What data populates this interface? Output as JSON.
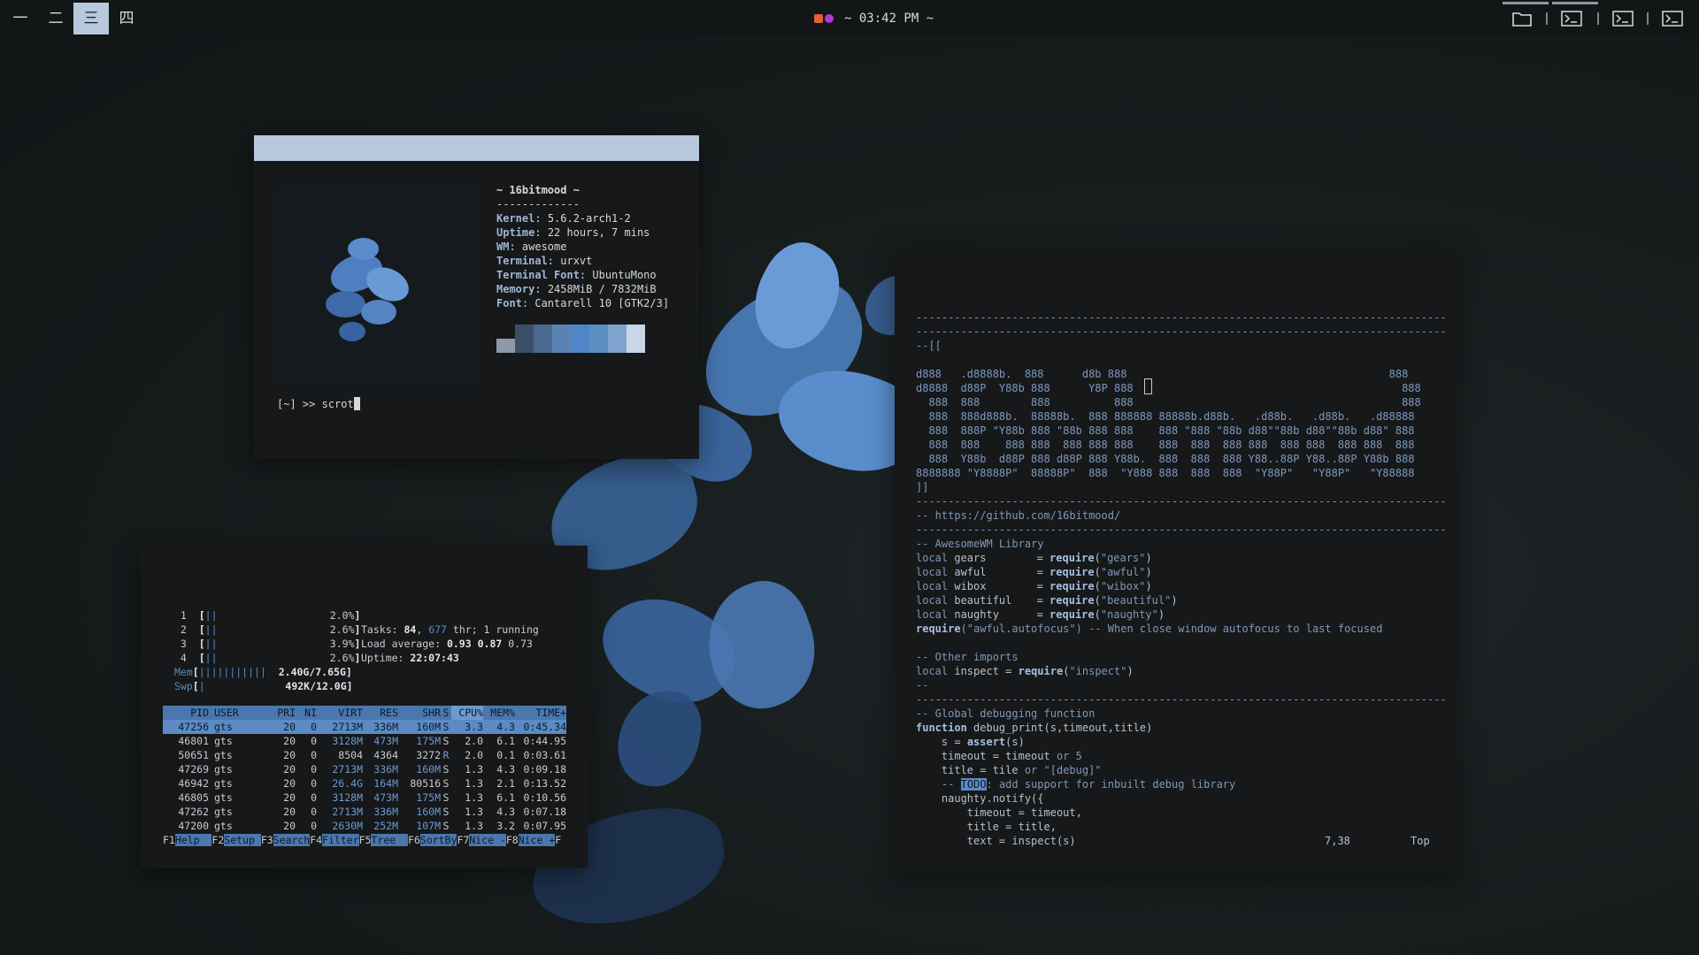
{
  "topbar": {
    "tags": [
      "一",
      "二",
      "三",
      "四"
    ],
    "active_tag_index": 2,
    "clock": "~ 03:42 PM ~",
    "tray_icons": [
      "folder-icon",
      "terminal-icon",
      "terminal-icon",
      "terminal-icon"
    ]
  },
  "neofetch": {
    "header": "~ 16bitmood ~",
    "divider": "-------------",
    "fields": [
      {
        "key": "Kernel",
        "value": "5.6.2-arch1-2"
      },
      {
        "key": "Uptime",
        "value": "22 hours, 7 mins"
      },
      {
        "key": "WM",
        "value": "awesome"
      },
      {
        "key": "Terminal",
        "value": "urxvt"
      },
      {
        "key": "Terminal Font",
        "value": "UbuntuMono"
      },
      {
        "key": "Memory",
        "value": "2458MiB / 7832MiB"
      },
      {
        "key": "Font",
        "value": "Cantarell 10 [GTK2/3]"
      }
    ],
    "swatch_colors": [
      "#8d99a6",
      "#3b4f66",
      "#4a6a92",
      "#5a82b3",
      "#4f86c9",
      "#5a8fc0",
      "#7fa3cf",
      "#c8d6e8"
    ],
    "prompt": "[~] >> scrot"
  },
  "htop": {
    "cpus": [
      {
        "n": "1",
        "pct": "2.0%"
      },
      {
        "n": "2",
        "pct": "2.6%"
      },
      {
        "n": "3",
        "pct": "3.9%"
      },
      {
        "n": "4",
        "pct": "2.6%"
      }
    ],
    "mem": {
      "label": "Mem",
      "value": "2.40G/7.65G"
    },
    "swp": {
      "label": "Swp",
      "value": "492K/12.0G"
    },
    "tasks_label": "Tasks:",
    "tasks": "84",
    "threads": "677",
    "running_text": "thr; 1 running",
    "load_label": "Load average:",
    "load": [
      "0.93",
      "0.87",
      "0.73"
    ],
    "uptime_label": "Uptime:",
    "uptime": "22:07:43",
    "columns": [
      "PID",
      "USER",
      "PRI",
      "NI",
      "VIRT",
      "RES",
      "SHR",
      "S",
      "CPU%",
      "MEM%",
      "TIME+"
    ],
    "rows": [
      [
        "47256",
        "gts",
        "20",
        "0",
        "2713M",
        "336M",
        "160M",
        "S",
        "3.3",
        "4.3",
        "0:45.34"
      ],
      [
        "46801",
        "gts",
        "20",
        "0",
        "3128M",
        "473M",
        "175M",
        "S",
        "2.0",
        "6.1",
        "0:44.95"
      ],
      [
        "50651",
        "gts",
        "20",
        "0",
        "8504",
        "4364",
        "3272",
        "R",
        "2.0",
        "0.1",
        "0:03.61"
      ],
      [
        "47269",
        "gts",
        "20",
        "0",
        "2713M",
        "336M",
        "160M",
        "S",
        "1.3",
        "4.3",
        "0:09.18"
      ],
      [
        "46942",
        "gts",
        "20",
        "0",
        "26.4G",
        "164M",
        "80516",
        "S",
        "1.3",
        "2.1",
        "0:13.52"
      ],
      [
        "46805",
        "gts",
        "20",
        "0",
        "3128M",
        "473M",
        "175M",
        "S",
        "1.3",
        "6.1",
        "0:10.56"
      ],
      [
        "47262",
        "gts",
        "20",
        "0",
        "2713M",
        "336M",
        "160M",
        "S",
        "1.3",
        "4.3",
        "0:07.18"
      ],
      [
        "47200",
        "gts",
        "20",
        "0",
        "2630M",
        "252M",
        "107M",
        "S",
        "1.3",
        "3.2",
        "0:07.95"
      ]
    ],
    "fkeys": [
      {
        "key": "F1",
        "label": "Help  "
      },
      {
        "key": "F2",
        "label": "Setup "
      },
      {
        "key": "F3",
        "label": "Search"
      },
      {
        "key": "F4",
        "label": "Filter"
      },
      {
        "key": "F5",
        "label": "Tree  "
      },
      {
        "key": "F6",
        "label": "SortBy"
      },
      {
        "key": "F7",
        "label": "Nice -"
      },
      {
        "key": "F8",
        "label": "Nice +"
      },
      {
        "key": "F",
        "label": ""
      }
    ]
  },
  "vim": {
    "dashes": "-----------------------------------------------------------------------------------",
    "open_comment": "--[[",
    "ascii_art": [
      "d888   .d8888b.  888      d8b 888                                         888",
      "d8888  d88P  Y88b 888      Y8P 888                                          888",
      "  888  888        888          888                                          888",
      "  888  888d888b.  88888b.  888 888888 88888b.d88b.   .d88b.   .d88b.   .d88888",
      "  888  888P \"Y88b 888 \"88b 888 888    888 \"888 \"88b d88\"\"88b d88\"\"88b d88\" 888",
      "  888  888    888 888  888 888 888    888  888  888 888  888 888  888 888  888",
      "  888  Y88b  d88P 888 d88P 888 Y88b.  888  888  888 Y88..88P Y88..88P Y88b 888",
      "8888888 \"Y8888P\"  88888P\"  888  \"Y888 888  888  888  \"Y88P\"   \"Y88P\"   \"Y88888"
    ],
    "close_comment": "]]",
    "github": "-- https://github.com/16bitmood/",
    "library_comment": "-- AwesomeWM Library",
    "requires": [
      {
        "name": "gears",
        "mod": "\"gears\""
      },
      {
        "name": "awful",
        "mod": "\"awful\""
      },
      {
        "name": "wibox",
        "mod": "\"wibox\""
      },
      {
        "name": "beautiful",
        "mod": "\"beautiful\""
      },
      {
        "name": "naughty",
        "mod": "\"naughty\""
      }
    ],
    "autofocus_mod": "(\"awful.autofocus\")",
    "autofocus_comment": "-- When close window autofocus to last focused",
    "other_comment": "-- Other imports",
    "inspect_name": "inspect",
    "inspect_mod": "\"inspect\"",
    "dashdash": "--",
    "debug_comment": "-- Global debugging function",
    "func_sig": "debug_print(s,timeout,title)",
    "body": {
      "s_assert": "s = ",
      "s_arg": "(s)",
      "timeout_line": "timeout = timeout ",
      "timeout_default": "5",
      "title_line": "title = tile ",
      "title_default": "\"[debug]\"",
      "todo_prefix": "-- ",
      "todo_tag": "TODO",
      "todo_rest": ": add support for inbuilt debug library",
      "notify": "naughty.notify({",
      "n1": "timeout = timeout,",
      "n2": "title = title,",
      "n3": "text = inspect(s)"
    },
    "position": "7,38",
    "scroll": "Top"
  }
}
